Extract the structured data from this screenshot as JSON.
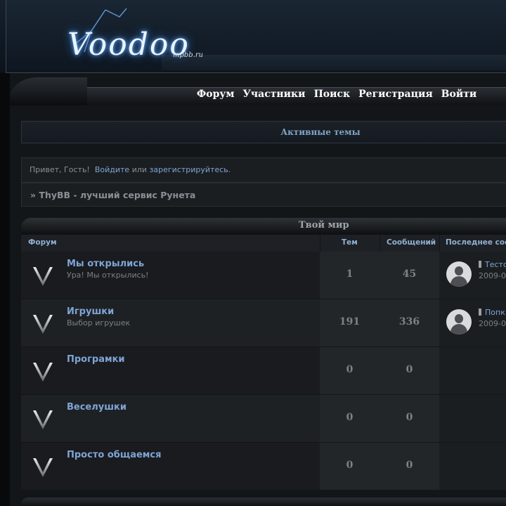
{
  "logo": {
    "text": "Voodoo",
    "domain": "mpbb.ru"
  },
  "nav": [
    "Форум",
    "Участники",
    "Поиск",
    "Регистрация",
    "Войти"
  ],
  "active_topics": "Активные темы",
  "greeting": {
    "prefix": "Привет, Гость!",
    "login": "Войдите",
    "or": "или",
    "register": "зарегистрируйтесь",
    "suffix": "."
  },
  "news": "» ThyBB - лучший сервис Рунета",
  "category": {
    "title": "Твой мир",
    "columns": {
      "forum": "Форум",
      "topics": "Тем",
      "posts": "Сообщений",
      "last": "Последнее соо"
    },
    "forums": [
      {
        "name": "Мы открылись",
        "desc": "Ура! Мы открылись!",
        "topics": "1",
        "posts": "45",
        "last_title": "Тесто",
        "last_date": "2009-0"
      },
      {
        "name": "Игрушки",
        "desc": "Выбор игрушек",
        "topics": "191",
        "posts": "336",
        "last_title": "Попк",
        "last_date": "2009-0"
      },
      {
        "name": "Програмки",
        "desc": "",
        "topics": "0",
        "posts": "0",
        "last_title": "",
        "last_date": ""
      },
      {
        "name": "Веселушки",
        "desc": "",
        "topics": "0",
        "posts": "0",
        "last_title": "",
        "last_date": ""
      },
      {
        "name": "Просто общаемся",
        "desc": "",
        "topics": "0",
        "posts": "0",
        "last_title": "",
        "last_date": ""
      }
    ]
  },
  "icons": {
    "forum": "v-forum-icon",
    "avatar": "user-avatar-icon",
    "pin": "topic-pin-icon"
  }
}
